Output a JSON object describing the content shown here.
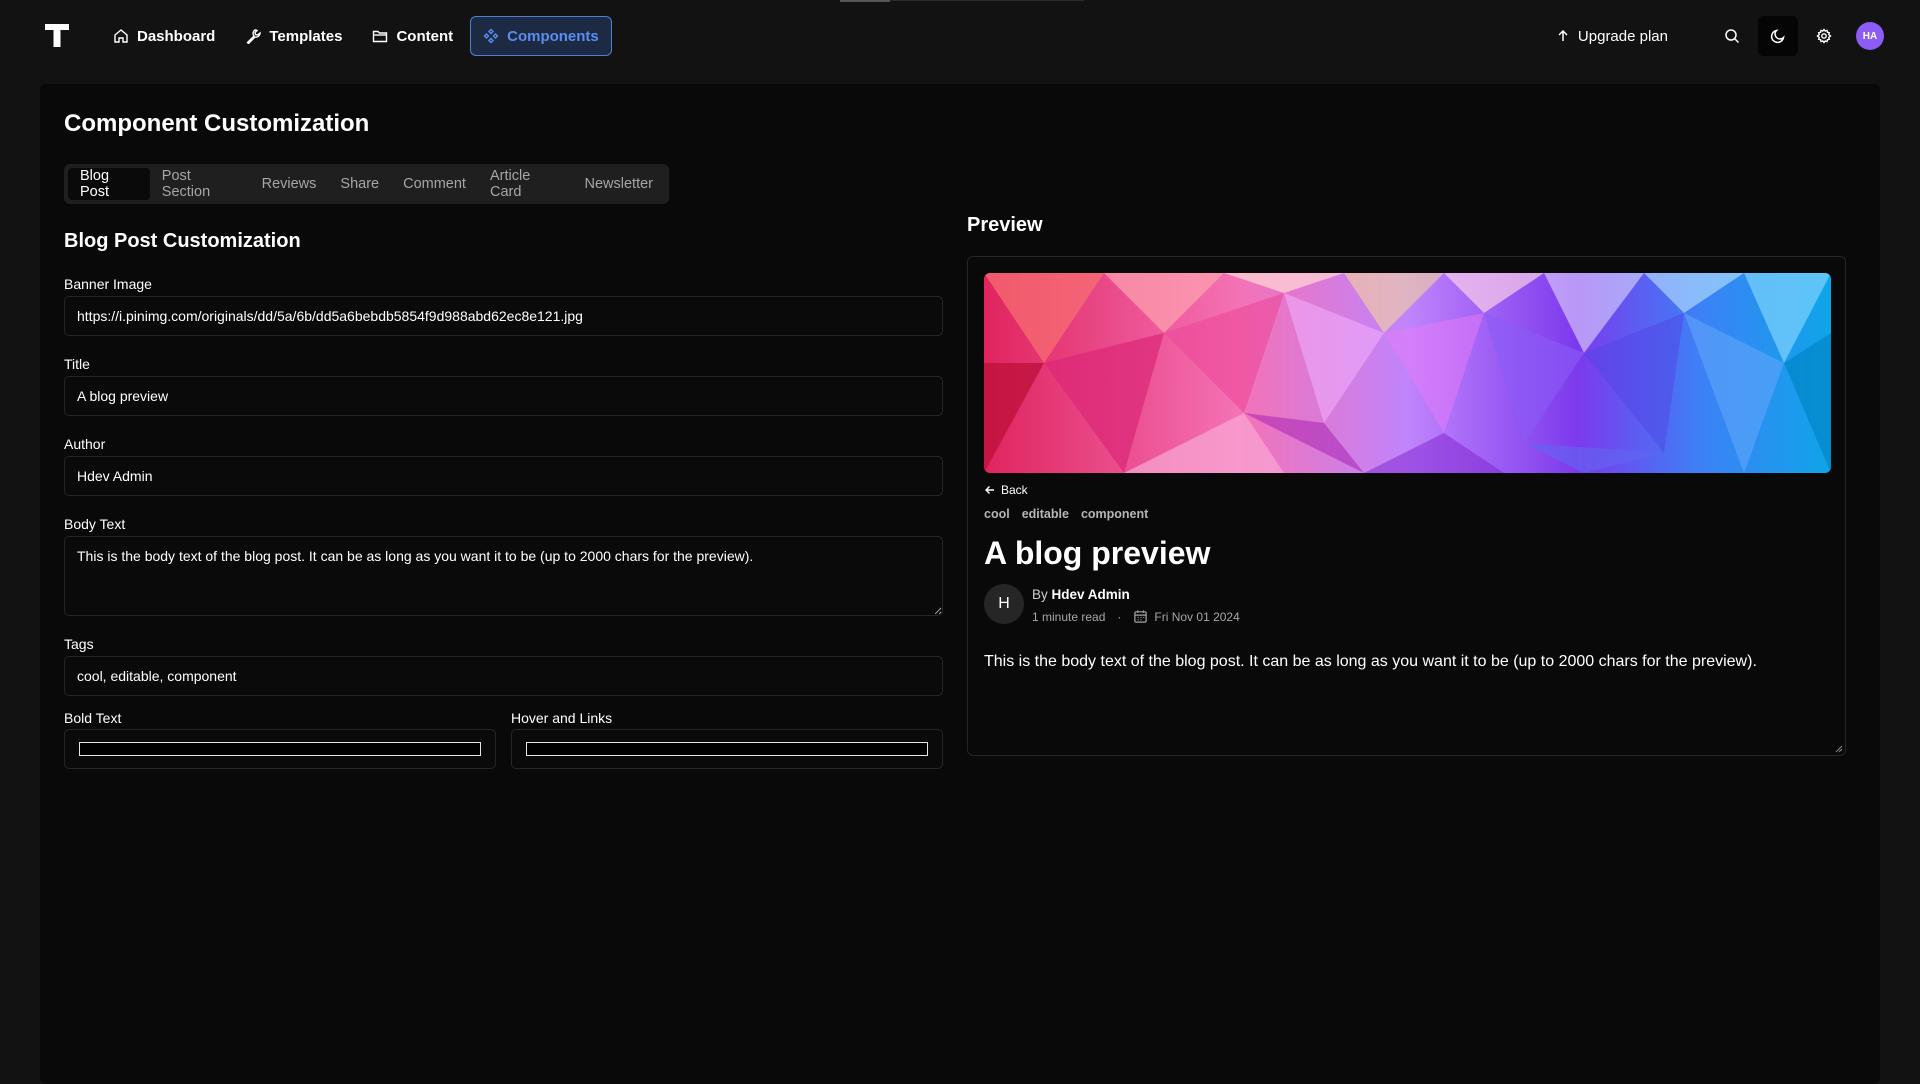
{
  "topbar": {
    "nav": [
      {
        "label": "Dashboard",
        "icon": "home-icon"
      },
      {
        "label": "Templates",
        "icon": "wrench-icon"
      },
      {
        "label": "Content",
        "icon": "folder-icon"
      },
      {
        "label": "Components",
        "icon": "components-icon",
        "active": true
      }
    ],
    "upgrade_label": "Upgrade plan",
    "avatar_initials": "HA"
  },
  "page": {
    "title": "Component Customization",
    "tabs": [
      "Blog Post",
      "Post Section",
      "Reviews",
      "Share",
      "Comment",
      "Article Card",
      "Newsletter"
    ],
    "active_tab": "Blog Post"
  },
  "form": {
    "title": "Blog Post Customization",
    "banner_label": "Banner Image",
    "banner_value": "https://i.pinimg.com/originals/dd/5a/6b/dd5a6bebdb5854f9d988abd62ec8e121.jpg",
    "title_label": "Title",
    "title_value": "A blog preview",
    "author_label": "Author",
    "author_value": "Hdev Admin",
    "body_label": "Body Text",
    "body_value": "This is the body text of the blog post. It can be as long as you want it to be (up to 2000 chars for the preview).",
    "tags_label": "Tags",
    "tags_value": "cool, editable, component",
    "bold_label": "Bold Text",
    "bold_color": "#000000",
    "hover_label": "Hover and Links",
    "hover_color": "#000000"
  },
  "preview": {
    "heading": "Preview",
    "back_label": "Back",
    "tags": [
      "cool",
      "editable",
      "component"
    ],
    "title": "A blog preview",
    "avatar_letter": "H",
    "by_prefix": "By",
    "author": "Hdev Admin",
    "read_time": "1 minute read",
    "dot": "·",
    "date": "Fri Nov 01 2024",
    "body": "This is the body text of the blog post. It can be as long as you want it to be (up to 2000 chars for the preview)."
  },
  "colors": {
    "background": "#121212",
    "panel": "#090909",
    "accent": "#5b8cf0",
    "avatar": "#8b5cf6"
  }
}
